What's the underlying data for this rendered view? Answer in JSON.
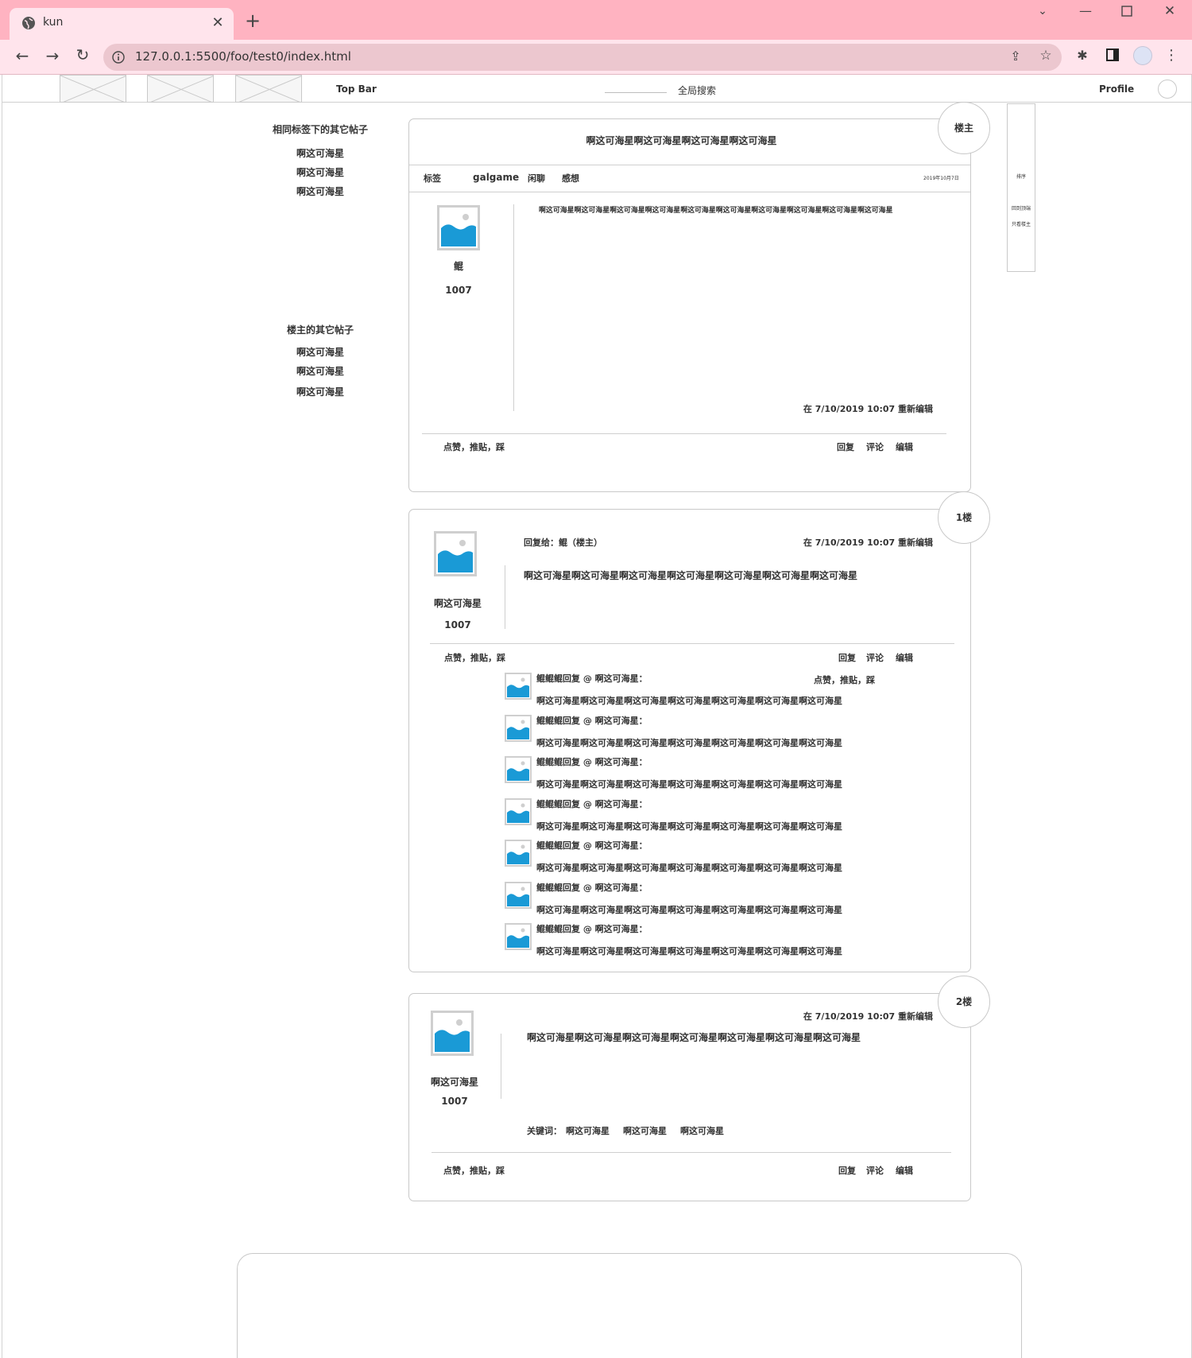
{
  "browser": {
    "tab_title": "kun",
    "url": "127.0.0.1:5500/foo/test0/index.html"
  },
  "topbar": {
    "label": "Top Bar",
    "search_label": "全局搜索",
    "profile_label": "Profile"
  },
  "sidebar": {
    "section1_title": "相同标签下的其它帖子",
    "section1_items": [
      "啊这可海星",
      "啊这可海星",
      "啊这可海星"
    ],
    "section2_title": "楼主的其它帖子",
    "section2_items": [
      "啊这可海星",
      "啊这可海星",
      "啊这可海星"
    ]
  },
  "right_panel": {
    "sort": "排序",
    "back_to_top": "回到顶端",
    "only_op": "只看楼主"
  },
  "post_main": {
    "floor": "楼主",
    "title": "啊这可海星啊这可海星啊这可海星啊这可海星",
    "tags_label": "标签",
    "tags": [
      "galgame",
      "闲聊",
      "感想"
    ],
    "date": "2019年10月7日",
    "author_name": "鲲",
    "author_count": "1007",
    "content": "啊这可海星啊这可海星啊这可海星啊这可海星啊这可海星啊这可海星啊这可海星啊这可海星啊这可海星啊这可海星",
    "edit_note": "在 7/10/2019 10:07 重新编辑",
    "reactions": "点赞，推贴，踩",
    "actions": [
      "回复",
      "评论",
      "编辑"
    ]
  },
  "post_1": {
    "floor": "1楼",
    "reply_to": "回复给：鲲（楼主）",
    "edit_note": "在 7/10/2019 10:07 重新编辑",
    "content": "啊这可海星啊这可海星啊这可海星啊这可海星啊这可海星啊这可海星啊这可海星",
    "author_name": "啊这可海星",
    "author_count": "1007",
    "reactions": "点赞，推贴，踩",
    "actions": [
      "回复",
      "评论",
      "编辑"
    ],
    "comment_reactions": "点赞，推贴，踩",
    "comments": [
      {
        "header": "鲲鲲鲲回复 @ 啊这可海星：",
        "text": "啊这可海星啊这可海星啊这可海星啊这可海星啊这可海星啊这可海星啊这可海星"
      },
      {
        "header": "鲲鲲鲲回复 @ 啊这可海星：",
        "text": "啊这可海星啊这可海星啊这可海星啊这可海星啊这可海星啊这可海星啊这可海星"
      },
      {
        "header": "鲲鲲鲲回复 @ 啊这可海星：",
        "text": "啊这可海星啊这可海星啊这可海星啊这可海星啊这可海星啊这可海星啊这可海星"
      },
      {
        "header": "鲲鲲鲲回复 @ 啊这可海星：",
        "text": "啊这可海星啊这可海星啊这可海星啊这可海星啊这可海星啊这可海星啊这可海星"
      },
      {
        "header": "鲲鲲鲲回复 @ 啊这可海星：",
        "text": "啊这可海星啊这可海星啊这可海星啊这可海星啊这可海星啊这可海星啊这可海星"
      },
      {
        "header": "鲲鲲鲲回复 @ 啊这可海星：",
        "text": "啊这可海星啊这可海星啊这可海星啊这可海星啊这可海星啊这可海星啊这可海星"
      },
      {
        "header": "鲲鲲鲲回复 @ 啊这可海星：",
        "text": "啊这可海星啊这可海星啊这可海星啊这可海星啊这可海星啊这可海星啊这可海星"
      }
    ]
  },
  "post_2": {
    "floor": "2楼",
    "edit_note": "在 7/10/2019 10:07 重新编辑",
    "content": "啊这可海星啊这可海星啊这可海星啊这可海星啊这可海星啊这可海星啊这可海星",
    "author_name": "啊这可海星",
    "author_count": "1007",
    "keywords_label": "关键词：",
    "keywords": [
      "啊这可海星",
      "啊这可海星",
      "啊这可海星"
    ],
    "reactions": "点赞，推贴，踩",
    "actions": [
      "回复",
      "评论",
      "编辑"
    ]
  },
  "colors": {
    "chrome_bg": "#ffb3c1",
    "tab_bg": "#ffe4ec",
    "image_blue": "#1a9ad6"
  }
}
